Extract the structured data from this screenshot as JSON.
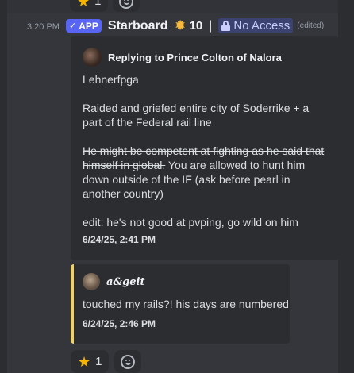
{
  "message": {
    "time": "3:20 PM",
    "app_badge": "APP",
    "bot_name": "Starboard",
    "star_count": "10",
    "separator": "|",
    "channel_access": "No Access",
    "edited": "(edited)"
  },
  "top_reactions": {
    "star_count": "1"
  },
  "embed_reply": {
    "author": "Replying to Prince Colton of Nalora",
    "name_line": "Lehnerfpga",
    "paragraph1": "Raided and griefed entire city of Soderrike + a part of the Federal rail line",
    "strike_text": "He might be competent at fighting as he said that himself in global.",
    "paragraph3_rest": " You are allowed to hunt him down outside of the IF (ask before pearl in another country)",
    "edit_note": "edit: he's not good at pvping, go wild on him",
    "timestamp": "6/24/25, 2:41 PM"
  },
  "embed_quote": {
    "author": "a&geit",
    "text": "touched my rails?! his days are numbered",
    "timestamp": "6/24/25, 2:46 PM",
    "accent_color": "#f0d264"
  },
  "bottom_reactions": {
    "star_count": "1"
  },
  "icons": [
    "star-icon",
    "smiley-icon",
    "checkmark-icon",
    "sun-icon",
    "lock-icon"
  ]
}
